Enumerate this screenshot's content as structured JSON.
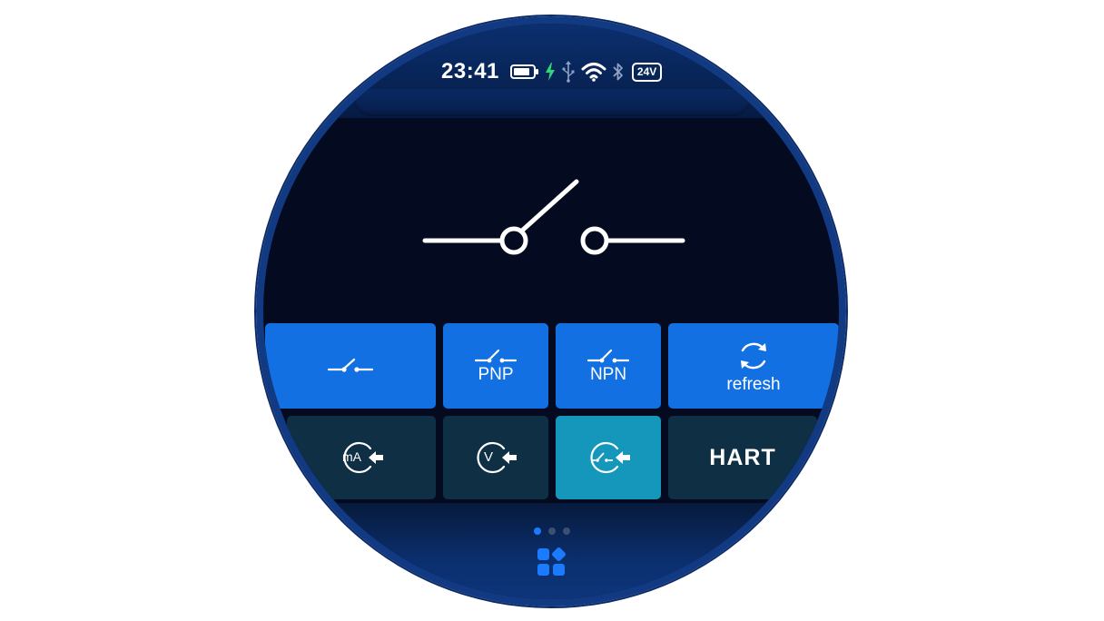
{
  "status": {
    "time": "23:41",
    "supply_badge": "24V",
    "icons": [
      "battery-icon",
      "charging-bolt-icon",
      "usb-icon",
      "wifi-icon",
      "bluetooth-icon"
    ],
    "bolt_color": "#2ed87a"
  },
  "display": {
    "icon": "open-switch-icon"
  },
  "buttons": {
    "row1": [
      {
        "label": "",
        "icon": "switch-icon"
      },
      {
        "label": "PNP",
        "icon": "switch-icon"
      },
      {
        "label": "NPN",
        "icon": "switch-icon"
      },
      {
        "label": "refresh",
        "icon": "refresh-icon"
      }
    ],
    "row2": [
      {
        "label": "mA",
        "icon": "ma-input-icon"
      },
      {
        "label": "V",
        "icon": "voltage-input-icon"
      },
      {
        "label": "",
        "icon": "switch-input-icon",
        "active": true
      },
      {
        "label": "HART",
        "icon": ""
      }
    ]
  },
  "pager": {
    "page_count": 3,
    "active_page": 1
  },
  "dock": {
    "icon": "apps-grid-icon"
  },
  "colors": {
    "button_blue": "#1370e3",
    "button_dark": "#0e2f44",
    "button_active": "#1497ba",
    "accent": "#1a7bff"
  }
}
